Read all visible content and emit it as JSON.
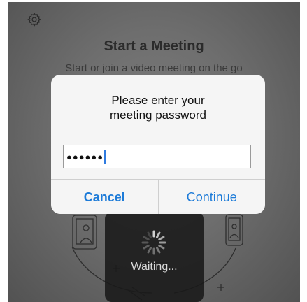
{
  "screen": {
    "title": "Start a Meeting",
    "subtitle": "Start or join a video meeting on the go"
  },
  "icons": {
    "settings": "gear-icon"
  },
  "dialog": {
    "message": "Please enter your\nmeeting password",
    "password_masked": "●●●●●●",
    "cancel_label": "Cancel",
    "continue_label": "Continue"
  },
  "hud": {
    "waiting_text": "Waiting..."
  },
  "colors": {
    "accent": "#1d7bd8",
    "caret": "#2f7be0"
  }
}
